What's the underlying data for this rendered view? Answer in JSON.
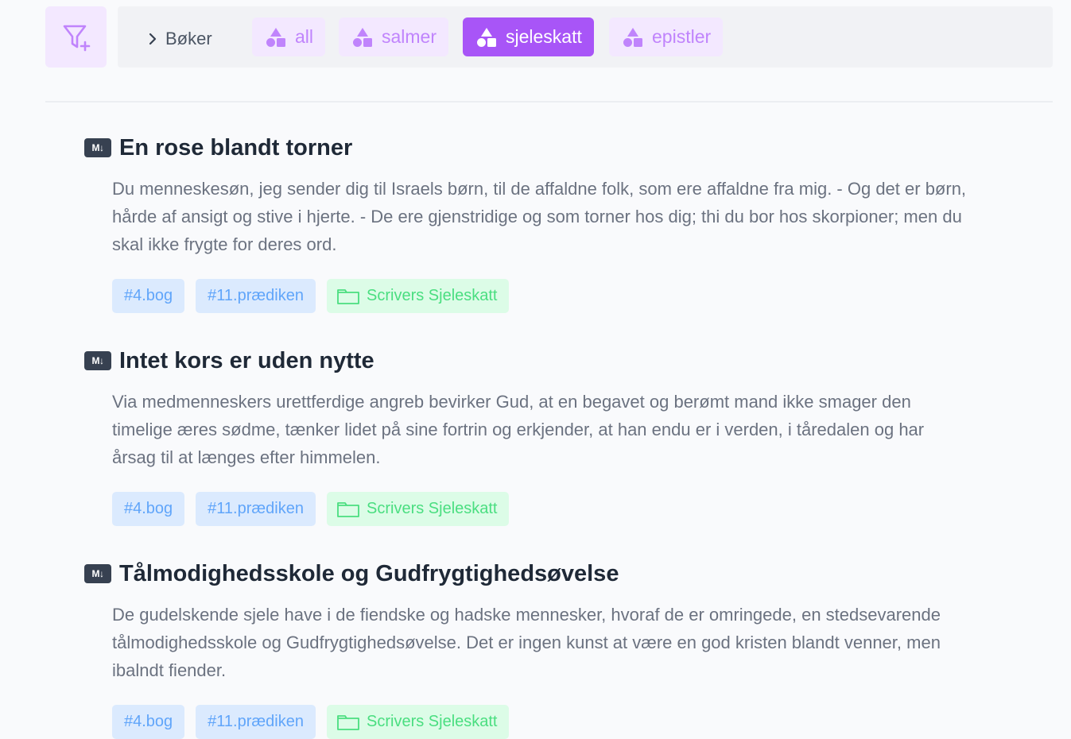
{
  "breadcrumb": {
    "label": "Bøker",
    "icon": "chevron-right-icon"
  },
  "filter_button": {
    "icon": "filter-plus-icon"
  },
  "collections": [
    {
      "label": "all",
      "active": false,
      "icon": "shapes-icon"
    },
    {
      "label": "salmer",
      "active": false,
      "icon": "shapes-icon"
    },
    {
      "label": "sjeleskatt",
      "active": true,
      "icon": "shapes-icon"
    },
    {
      "label": "epistler",
      "active": false,
      "icon": "shapes-icon"
    }
  ],
  "entries": [
    {
      "badge": "M↓",
      "title": "En rose blandt torner",
      "excerpt": "Du menneskesøn, jeg sender dig til Israels børn, til de affaldne folk, som ere affaldne fra mig. - Og det er børn, hårde af ansigt og stive i hjerte. - De ere gjenstridige og som torner hos dig; thi du bor hos skorpioner; men du skal ikke frygte for deres ord.",
      "tags": [
        "#4.bog",
        "#11.prædiken"
      ],
      "source": "Scrivers Sjeleskatt"
    },
    {
      "badge": "M↓",
      "title": "Intet kors er uden nytte",
      "excerpt": "Via medmenneskers urettferdige angreb bevirker Gud, at en begavet og berømt mand ikke smager den timelige æres sødme, tænker lidet på sine fortrin og erkjender, at han endu er i verden, i tåredalen og har årsag til at længes efter himmelen.",
      "tags": [
        "#4.bog",
        "#11.prædiken"
      ],
      "source": "Scrivers Sjeleskatt"
    },
    {
      "badge": "M↓",
      "title": "Tålmodighedsskole og Gudfrygtighedsøvelse",
      "excerpt": "De gudelskende sjele have i de fiendske og hadske mennesker, hvoraf de er omringede, en stedsevarende tålmodighedsskole og Gudfrygtighedsøvelse. Det er ingen kunst at være en god kristen blandt venner, men ibalndt fiender.",
      "tags": [
        "#4.bog",
        "#11.prædiken"
      ],
      "source": "Scrivers Sjeleskatt"
    }
  ],
  "colors": {
    "accent": "#a855f7",
    "accent_light": "#f3e8ff",
    "tag_blue_bg": "#dbeafe",
    "tag_blue_text": "#60a5fa",
    "tag_green_bg": "#dcfce7",
    "tag_green_text": "#4ade80"
  }
}
